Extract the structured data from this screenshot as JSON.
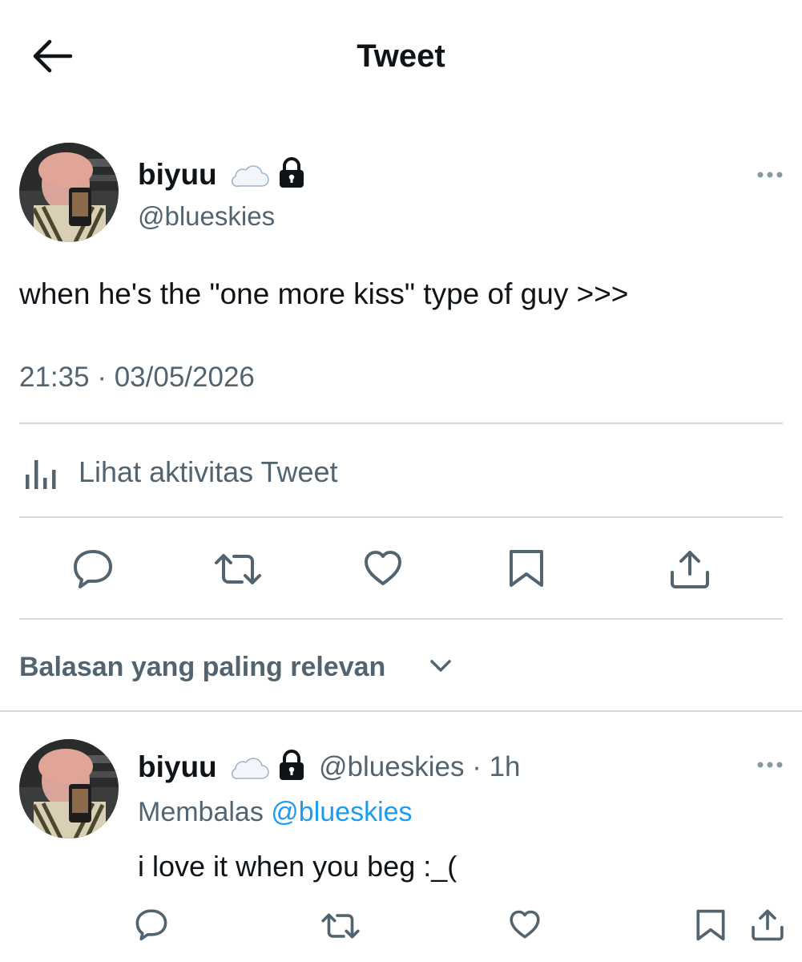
{
  "header": {
    "title": "Tweet",
    "back_icon": "arrow-left-icon"
  },
  "tweet": {
    "author": {
      "name": "biyuu",
      "emoji": "☁️",
      "handle": "@blueskies"
    },
    "text": "when he's the \"one more kiss\" type of guy >>>",
    "time": "21:35",
    "separator": "·",
    "date": "03/05/2026",
    "activity_label": "Lihat aktivitas Tweet"
  },
  "actions": [
    "reply-icon",
    "retweet-icon",
    "like-icon",
    "bookmark-icon",
    "share-icon"
  ],
  "replies": {
    "sort_label": "Balasan yang paling relevan",
    "items": [
      {
        "name": "biyuu",
        "emoji": "☁️",
        "handle": "@blueskies",
        "separator": "·",
        "time": "1h",
        "replying_prefix": "Membalas",
        "replying_to": "@blueskies",
        "text": "i love it when you beg :_("
      }
    ]
  },
  "colors": {
    "text": "#0f1419",
    "secondary": "#536471",
    "link": "#1d9bf0",
    "divider": "#cfd9de"
  }
}
